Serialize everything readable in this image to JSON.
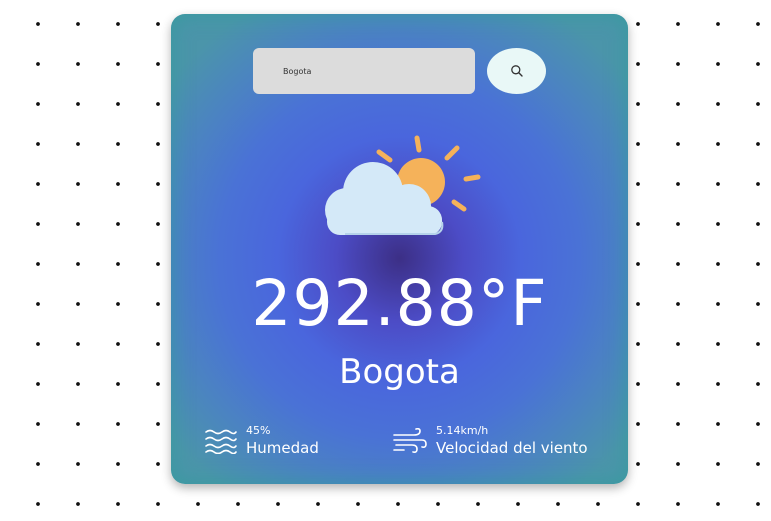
{
  "search": {
    "value": "Bogota",
    "placeholder": ""
  },
  "weather": {
    "icon": "cloud-sun-icon",
    "temperature": "292.88°F",
    "city": "Bogota"
  },
  "humidity": {
    "icon": "waves-icon",
    "value": "45%",
    "label": "Humedad"
  },
  "wind": {
    "icon": "wind-icon",
    "value": "5.14km/h",
    "label": "Velocidad del viento"
  },
  "colors": {
    "card_center": "#3c2f86",
    "card_mid": "#4a66dd",
    "card_edge": "#4b95aa",
    "search_input_bg": "#dcdcdc",
    "search_button_bg": "#e9f8f7",
    "sun": "#f5b25a",
    "cloud": "#d4e9f8"
  }
}
